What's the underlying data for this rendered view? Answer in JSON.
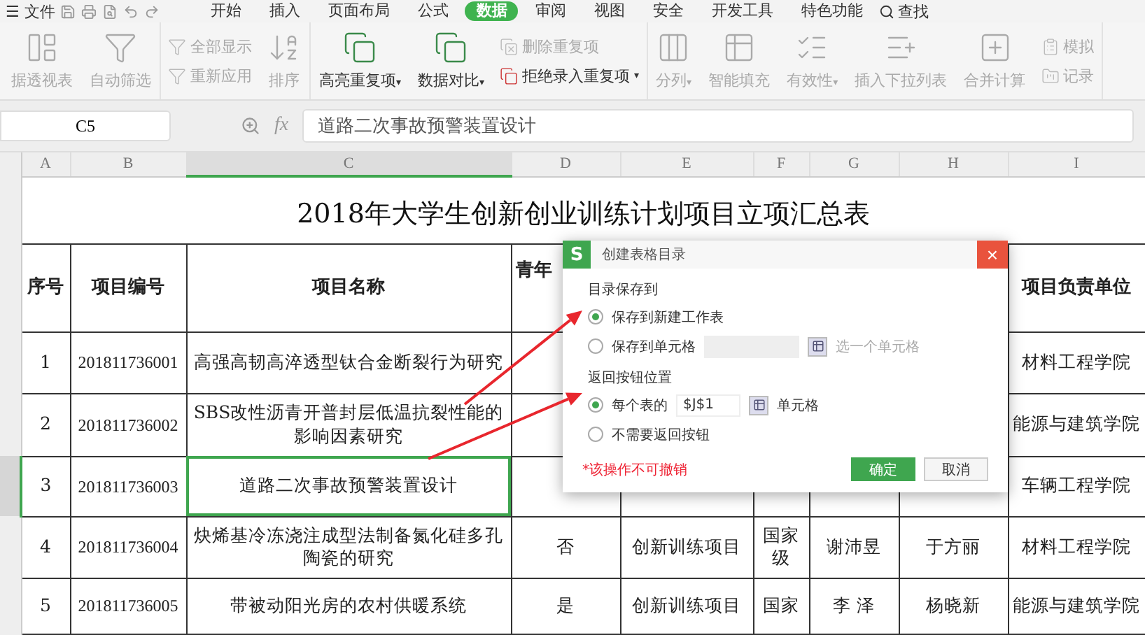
{
  "menu_bar": {
    "menu_glyph": "☰",
    "file_label": "文件",
    "tabs": [
      {
        "label": "开始",
        "selected": false
      },
      {
        "label": "插入",
        "selected": false
      },
      {
        "label": "页面布局",
        "selected": false
      },
      {
        "label": "公式",
        "selected": false
      },
      {
        "label": "数据",
        "selected": true
      },
      {
        "label": "审阅",
        "selected": false
      },
      {
        "label": "视图",
        "selected": false
      },
      {
        "label": "安全",
        "selected": false
      },
      {
        "label": "开发工具",
        "selected": false
      },
      {
        "label": "特色功能",
        "selected": false
      }
    ],
    "search_label": "查找"
  },
  "ribbon": {
    "columns": [
      {
        "items": [
          {
            "label": "据透视表",
            "disabled": true
          }
        ]
      },
      {
        "items": [
          {
            "label": "自动筛选",
            "disabled": true
          }
        ]
      },
      {
        "items": [
          {
            "label": "全部显示",
            "disabled": true
          },
          {
            "label": "重新应用",
            "disabled": true
          }
        ]
      },
      {
        "items": [
          {
            "label": "排序",
            "disabled": true
          }
        ]
      },
      {
        "items": [
          {
            "label": "高亮重复项",
            "disabled": false,
            "caret": "▾"
          }
        ]
      },
      {
        "items": [
          {
            "label": "数据对比",
            "disabled": false,
            "caret": "▾"
          }
        ]
      },
      {
        "items": [
          {
            "label": "删除重复项",
            "disabled": true
          },
          {
            "label": "拒绝录入重复项",
            "disabled": false,
            "caret": "▾"
          }
        ]
      },
      {
        "items": [
          {
            "label": "分列",
            "disabled": true,
            "caret": "▾"
          }
        ]
      },
      {
        "items": [
          {
            "label": "智能填充",
            "disabled": true
          }
        ]
      },
      {
        "items": [
          {
            "label": "有效性",
            "disabled": true,
            "caret": "▾"
          }
        ]
      },
      {
        "items": [
          {
            "label": "插入下拉列表",
            "disabled": true
          }
        ]
      },
      {
        "items": [
          {
            "label": "合并计算",
            "disabled": true
          }
        ]
      },
      {
        "items": [
          {
            "label": "模拟",
            "disabled": true
          },
          {
            "label": "记录",
            "disabled": true
          }
        ]
      }
    ]
  },
  "formula_bar": {
    "cell_reference": "C5",
    "formula_label": "fx",
    "value": "道路二次事故预警装置设计"
  },
  "sheet": {
    "columns": [
      {
        "label": "A",
        "selected": false
      },
      {
        "label": "B",
        "selected": false
      },
      {
        "label": "C",
        "selected": true
      },
      {
        "label": "D",
        "selected": false
      },
      {
        "label": "E",
        "selected": false
      },
      {
        "label": "F",
        "selected": false
      },
      {
        "label": "G",
        "selected": false
      },
      {
        "label": "H",
        "selected": false
      },
      {
        "label": "I",
        "selected": false
      }
    ],
    "title": "2018年大学生创新创业训练计划项目立项汇总表",
    "header": [
      "序号",
      "项目编号",
      "项目名称",
      "青年",
      "项目负责单位"
    ],
    "rows": [
      {
        "selected": false,
        "cells": [
          "1",
          "201811736001",
          "高强高韧高淬透型钛合金断裂行为研究",
          null,
          null,
          null,
          null,
          null,
          "材料工程学院"
        ]
      },
      {
        "selected": false,
        "cells": [
          "2",
          "201811736002",
          "SBS改性沥青开普封层低温抗裂性能的影响因素研究",
          null,
          null,
          null,
          null,
          null,
          "能源与建筑学院"
        ]
      },
      {
        "selected": true,
        "cells": [
          "3",
          "201811736003",
          "道路二次事故预警装置设计",
          null,
          null,
          null,
          null,
          null,
          "车辆工程学院"
        ]
      },
      {
        "selected": false,
        "cells": [
          "4",
          "201811736004",
          "炔烯基冷冻浇注成型法制备氮化硅多孔陶瓷的研究",
          "否",
          "创新训练项目",
          "国家级",
          "谢沛昱",
          "于方丽",
          "材料工程学院"
        ]
      },
      {
        "selected": false,
        "cells": [
          "5",
          "201811736005",
          "带被动阳光房的农村供暖系统",
          "是",
          "创新训练项目",
          "国家",
          "李 泽",
          "杨晓新",
          "能源与建筑学院"
        ]
      }
    ]
  },
  "dialog": {
    "logo": "S",
    "title": "创建表格目录",
    "close": "×",
    "sections": [
      {
        "label": "目录保存到",
        "options": [
          {
            "label": "保存到新建工作表",
            "selected": true,
            "kind": "plain"
          },
          {
            "label": "保存到单元格",
            "selected": false,
            "kind": "field",
            "disabled": true,
            "hint": "选一个单元格"
          }
        ]
      },
      {
        "label": "返回按钮位置",
        "options": [
          {
            "label": "每个表的",
            "selected": true,
            "kind": "field",
            "disabled": false,
            "value": "$J$1",
            "suffix": "单元格"
          },
          {
            "label": "不需要返回按钮",
            "selected": false,
            "kind": "plain"
          }
        ]
      }
    ],
    "warning": "*该操作不可撤销",
    "buttons": [
      {
        "label": "确定",
        "primary": true
      },
      {
        "label": "取消",
        "primary": false
      }
    ]
  }
}
